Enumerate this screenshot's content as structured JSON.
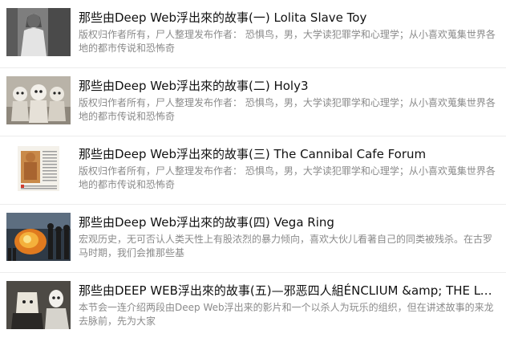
{
  "articles": [
    {
      "title": "那些由Deep Web浮出來的故事(一) Lolita Slave Toy",
      "description": "版权归作者所有，尸人整理发布作者： 恐惧鸟，男，大学读犯罪学和心理学；从小喜欢蒐集世界各地的都市传说和恐怖奇",
      "thumbnail_icon": "vintage-girl-photo"
    },
    {
      "title": "那些由Deep Web浮出來的故事(二) Holy3",
      "description": "版权归作者所有，尸人整理发布作者： 恐惧鸟，男，大学读犯罪学和心理学；从小喜欢蒐集世界各地的都市传说和恐怖奇",
      "thumbnail_icon": "three-dolls-photo"
    },
    {
      "title": "那些由Deep Web浮出來的故事(三) The Cannibal Cafe Forum",
      "description": "版权归作者所有，尸人整理发布作者： 恐惧鸟，男，大学读犯罪学和心理学；从小喜欢蒐集世界各地的都市传说和恐怖奇",
      "thumbnail_icon": "newspaper-clipping-photo"
    },
    {
      "title": "那些由Deep Web浮出來的故事(四) Vega Ring",
      "description": "宏观历史，无可否认人类天性上有股浓烈的暴力倾向，喜欢大伙儿看著自己的同类被残杀。在古罗马时期，我们会推那些基",
      "thumbnail_icon": "fire-crowd-photo"
    },
    {
      "title": "那些由DEEP WEB浮出來的故事(五)—邪恶四人組ÉNCLIUM &amp; THE LOST",
      "description": "本节会一连介绍两段由Deep Web浮出来的影片和一个以杀人为玩乐的组织，但在讲述故事的来龙去脉前，先为大家",
      "thumbnail_icon": "masked-figures-photo"
    }
  ]
}
